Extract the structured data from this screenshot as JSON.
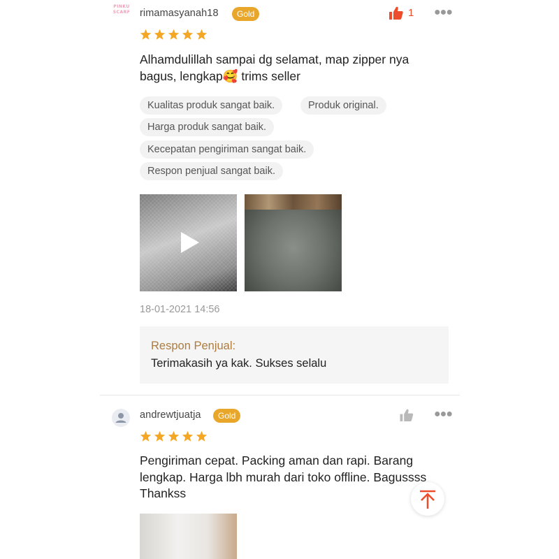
{
  "reviews": [
    {
      "avatar_text": "PINKU\nSCARF",
      "username": "rimamasyanah18",
      "badge": "Gold",
      "rating": 5,
      "likes": "1",
      "comment_line1": "Alhamdulillah sampai dg selamat, map zipper nya",
      "comment_line2": "bagus, lengkap🥰 trims seller",
      "chips": [
        "Kualitas produk sangat baik.",
        "Produk original.",
        "Harga produk sangat baik.",
        "Kecepatan pengiriman sangat baik.",
        "Respon penjual sangat baik."
      ],
      "timestamp": "18-01-2021 14:56",
      "seller_reply_title": "Respon Penjual:",
      "seller_reply_text": "Terimakasih ya kak. Sukses selalu"
    },
    {
      "username": "andrewtjuatja",
      "badge": "Gold",
      "rating": 5,
      "comment_line1": "Pengiriman cepat. Packing aman dan rapi. Barang",
      "comment_line2": "lengkap. Harga lbh murah dari toko offline. Bagussss",
      "comment_line3": "Thankss"
    }
  ],
  "icons": {
    "like_active": "thumbs-up-filled-icon",
    "like_inactive": "thumbs-up-icon",
    "more": "more-dots-icon",
    "star": "star-icon",
    "play": "play-icon",
    "scroll_top": "arrow-up-to-top-icon",
    "default_avatar": "person-icon"
  },
  "colors": {
    "accent": "#ee4d2d",
    "star": "#f5a623",
    "badge": "#e8a62a",
    "seller_reply_title": "#ad7c3e"
  }
}
